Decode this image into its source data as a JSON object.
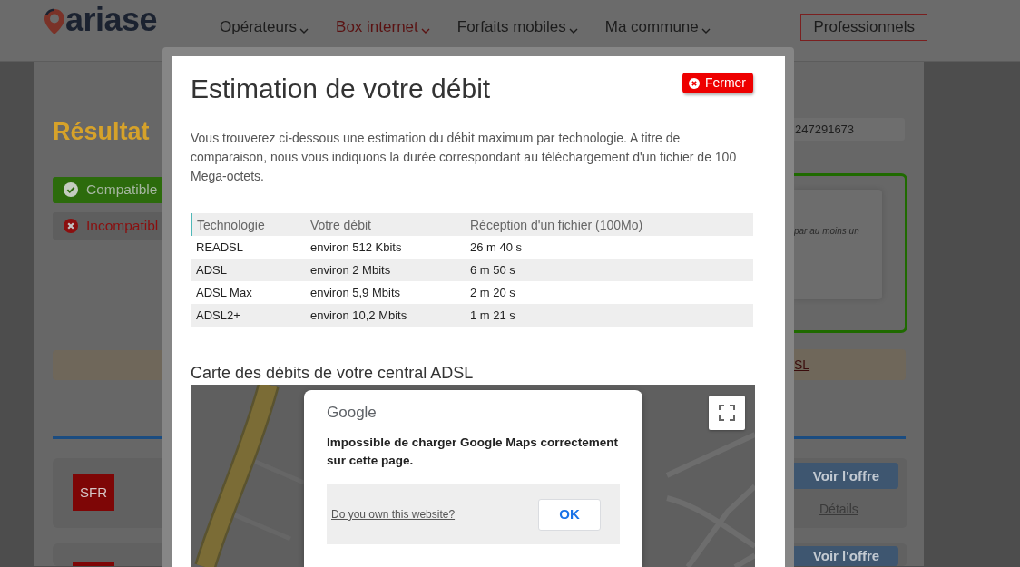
{
  "header": {
    "logo": "ariase",
    "nav": [
      {
        "label": "Opérateurs",
        "selected": false
      },
      {
        "label": "Box internet",
        "selected": true
      },
      {
        "label": "Forfaits mobiles",
        "selected": false
      },
      {
        "label": "Ma commune",
        "selected": false
      }
    ],
    "pro_button": "Professionnels"
  },
  "page": {
    "title": "Résultat",
    "badges": [
      {
        "kind": "compatible",
        "label": "Compatible"
      },
      {
        "kind": "incompatible",
        "label": "Incompatibl"
      }
    ],
    "number_field": "247291673",
    "eligibility_note": "par au moins un",
    "notice_link": "SL",
    "offers": [
      {
        "logo": "SFR",
        "button": "Voir l'offre",
        "details": "Détails"
      },
      {
        "button": "Voir l'offre"
      }
    ]
  },
  "modal": {
    "title": "Estimation de votre débit",
    "close_button": "Fermer",
    "intro": "Vous trouverez ci-dessous une estimation du débit maximum par technologie. A titre de comparaison, nous vous indiquons la durée correspondant au téléchargement d'un fichier de 100 Mega-octets.",
    "table": {
      "columns": [
        "Technologie",
        "Votre débit",
        "Réception d'un fichier (100Mo)"
      ],
      "rows": [
        [
          "READSL",
          "environ 512 Kbits",
          "26 m 40 s"
        ],
        [
          "ADSL",
          "environ 2 Mbits",
          "6 m 50 s"
        ],
        [
          "ADSL Max",
          "environ 5,9 Mbits",
          "2 m 20 s"
        ],
        [
          "ADSL2+",
          "environ 10,2 Mbits",
          "1 m 21 s"
        ]
      ]
    },
    "map_title": "Carte des débits de votre central ADSL",
    "map_error": {
      "logo": "Google",
      "message": "Impossible de charger Google Maps correctement sur cette page.",
      "link": "Do you own this website?",
      "button": "OK"
    }
  }
}
